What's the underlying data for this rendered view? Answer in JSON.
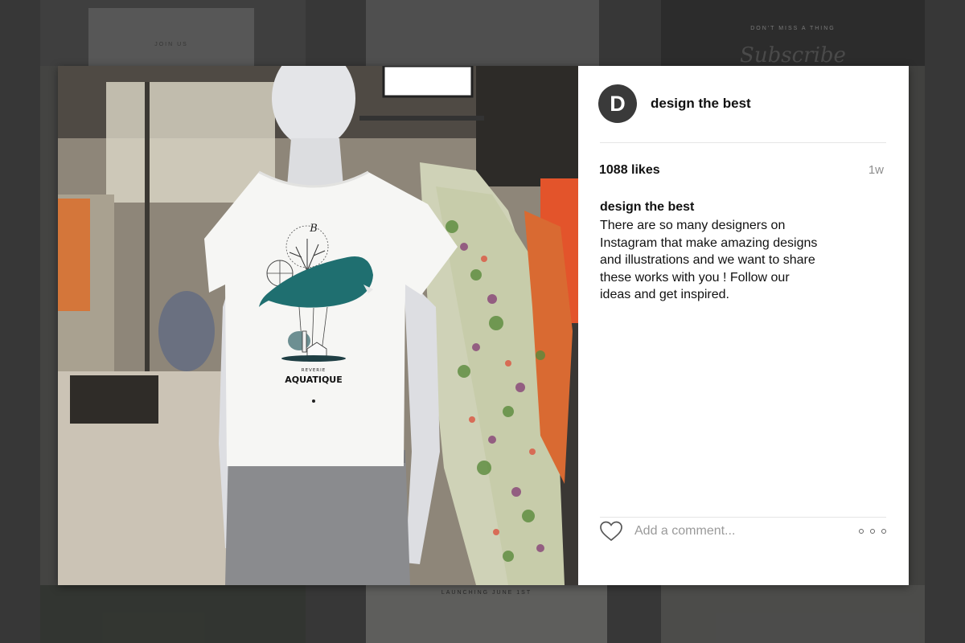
{
  "background": {
    "join_text": "JOIN US",
    "dont_miss_text": "DON'T MISS A THING",
    "subscribe_text": "Subscribe",
    "launching_text": "LAUNCHING JUNE 1ST"
  },
  "post": {
    "author_initial": "D",
    "author_name": "design the best",
    "likes": "1088 likes",
    "time_ago": "1w",
    "caption_author": "design the best",
    "caption_text": "There are so many designers on Instagram that make amazing designs and illustrations and we want to share these works with you ! Follow our ideas and get inspired.",
    "comment_placeholder": "Add a comment...",
    "tshirt_letter": "B",
    "tshirt_small": "REVERIE",
    "tshirt_title": "AQUATIQUE"
  },
  "colors": {
    "whale": "#1f6f70",
    "avatar": "#3a3a3a"
  },
  "icons": {
    "like": "heart-icon",
    "more": "more-dots-icon"
  }
}
